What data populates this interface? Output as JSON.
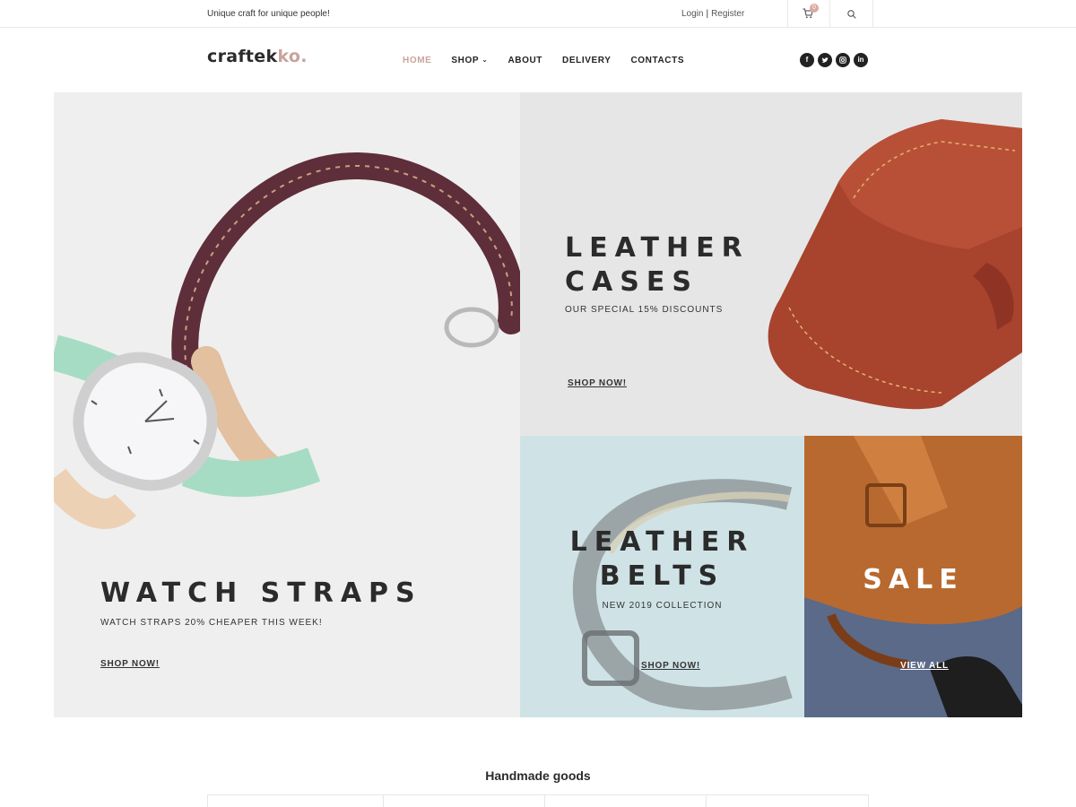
{
  "topbar": {
    "tagline": "Unique craft for unique people!",
    "login": "Login",
    "separator": "|",
    "register": "Register",
    "cart_count": "0"
  },
  "header": {
    "logo_main": "craftek",
    "logo_accent": "ko.",
    "nav": [
      {
        "label": "HOME"
      },
      {
        "label": "SHOP"
      },
      {
        "label": "ABOUT"
      },
      {
        "label": "DELIVERY"
      },
      {
        "label": "CONTACTS"
      }
    ],
    "social": [
      "facebook-icon",
      "twitter-icon",
      "instagram-icon",
      "linkedin-icon"
    ]
  },
  "hero": {
    "watch": {
      "title": "WATCH STRAPS",
      "subtitle": "WATCH STRAPS 20% CHEAPER THIS WEEK!",
      "cta": "SHOP NOW!"
    },
    "cases": {
      "title_line1": "LEATHER",
      "title_line2": "CASES",
      "subtitle": "OUR SPECIAL 15% DISCOUNTS",
      "cta": "SHOP NOW!"
    },
    "belts": {
      "title_line1": "LEATHER",
      "title_line2": "BELTS",
      "subtitle": "NEW 2019 COLLECTION",
      "cta": "SHOP NOW!"
    },
    "sale": {
      "title": "SALE",
      "cta": "VIEW ALL"
    }
  },
  "section": {
    "title": "Handmade goods"
  },
  "colors": {
    "accent": "#c9a39a",
    "text": "#2b2b2b",
    "belts_bg": "#cfe3e7"
  }
}
